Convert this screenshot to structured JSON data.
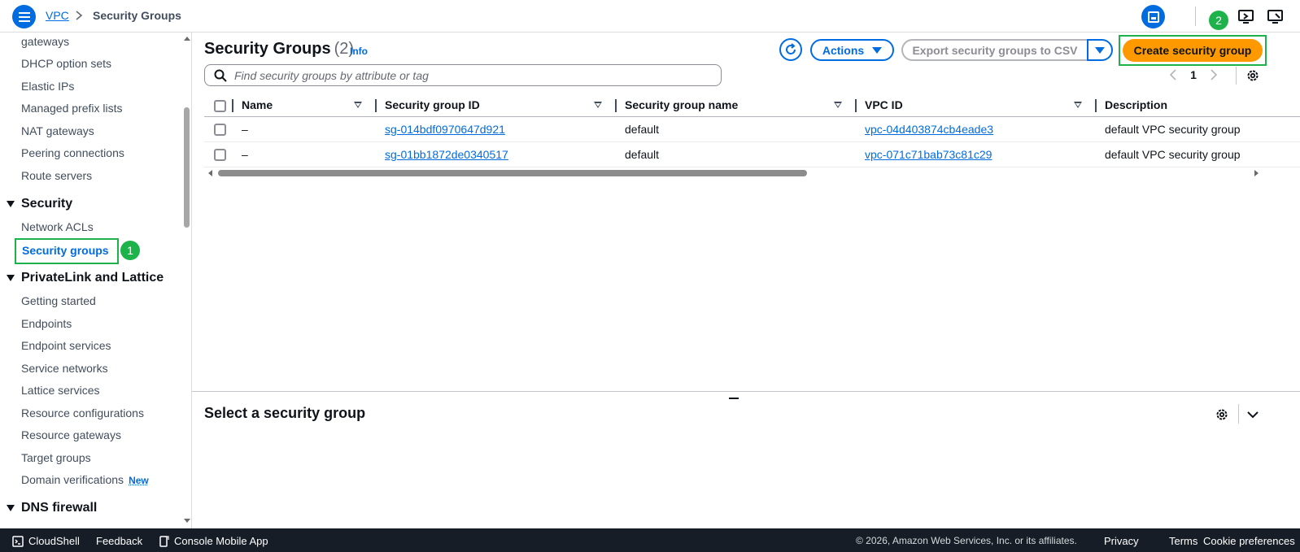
{
  "breadcrumb": {
    "root": "VPC",
    "current": "Security Groups"
  },
  "annotations": {
    "badge1": "1",
    "badge2": "2"
  },
  "sidebar": {
    "items_top": [
      "gateways",
      "DHCP option sets",
      "Elastic IPs",
      "Managed prefix lists",
      "NAT gateways",
      "Peering connections",
      "Route servers"
    ],
    "security_heading": "Security",
    "security_items": [
      "Network ACLs",
      "Security groups"
    ],
    "privatelink_heading": "PrivateLink and Lattice",
    "privatelink_items": [
      "Getting started",
      "Endpoints",
      "Endpoint services",
      "Service networks",
      "Lattice services",
      "Resource configurations",
      "Resource gateways",
      "Target groups",
      "Domain verifications"
    ],
    "new_badge": "New",
    "dns_heading": "DNS firewall"
  },
  "main": {
    "title": "Security Groups",
    "count": "(2)",
    "info": "Info",
    "actions_label": "Actions",
    "export_label": "Export security groups to CSV",
    "create_label": "Create security group",
    "search_placeholder": "Find security groups by attribute or tag",
    "page": "1"
  },
  "table": {
    "headers": [
      "Name",
      "Security group ID",
      "Security group name",
      "VPC ID",
      "Description"
    ],
    "rows": [
      {
        "name": "–",
        "sg_id": "sg-014bdf0970647d921",
        "sg_name": "default",
        "vpc_id": "vpc-04d403874cb4eade3",
        "description": "default VPC security group"
      },
      {
        "name": "–",
        "sg_id": "sg-01bb1872de0340517",
        "sg_name": "default",
        "vpc_id": "vpc-071c71bab73c81c29",
        "description": "default VPC security group"
      }
    ]
  },
  "detail": {
    "title": "Select a security group"
  },
  "footer": {
    "cloudshell": "CloudShell",
    "feedback": "Feedback",
    "mobile_app": "Console Mobile App",
    "copyright": "© 2026, Amazon Web Services, Inc. or its affiliates.",
    "privacy": "Privacy",
    "terms": "Terms",
    "cookies": "Cookie preferences"
  },
  "colors": {
    "accent": "#006ce0",
    "primary_button": "#ff9900",
    "annotation": "#1db34a",
    "footer_bg": "#161d26"
  },
  "icons": [
    "menu-icon",
    "chevron-right-icon",
    "layout-panel-icon",
    "screen-share-icon",
    "display-icon",
    "refresh-icon",
    "caret-down-icon",
    "search-icon",
    "settings-gear-icon",
    "chevron-left-icon",
    "chevron-down-icon",
    "terminal-icon",
    "mobile-icon"
  ]
}
